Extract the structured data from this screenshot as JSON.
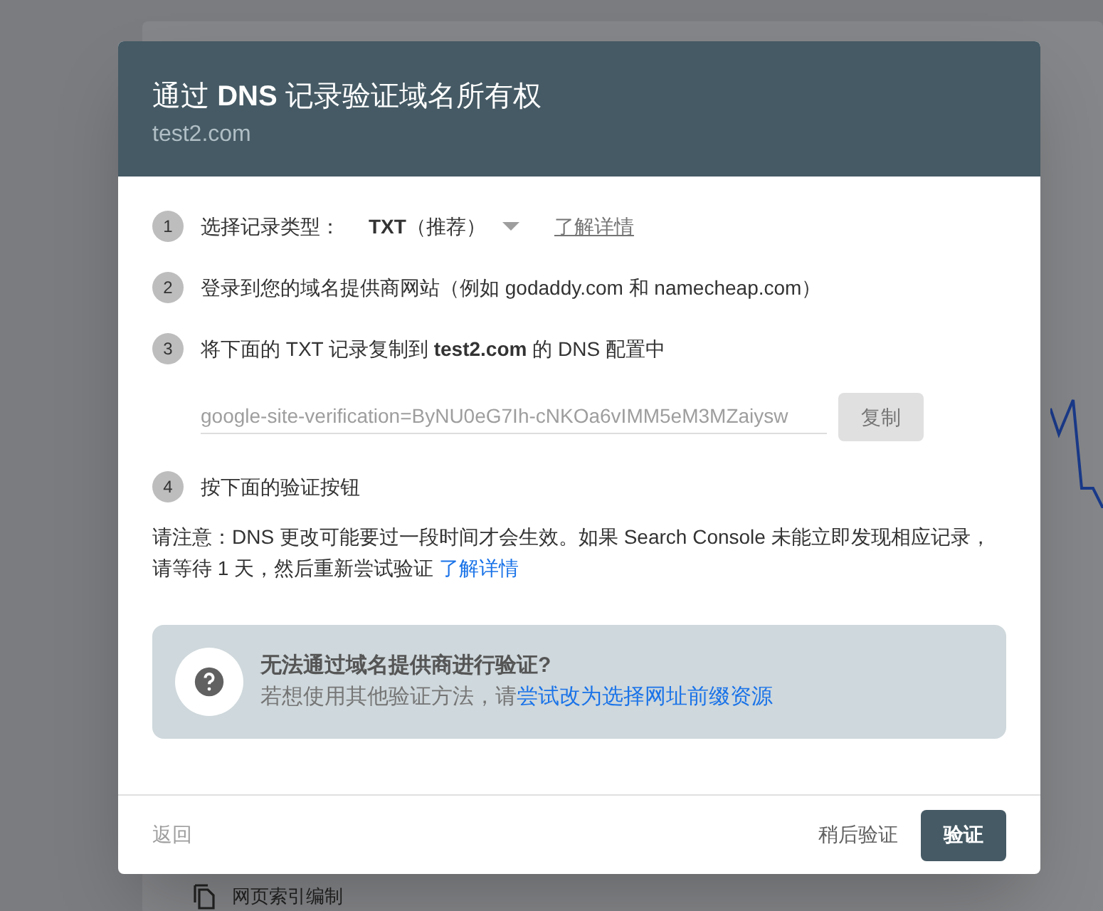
{
  "background": {
    "nav_item": {
      "label": "网页索引编制"
    }
  },
  "dialog": {
    "title": "通过 **DNS** 记录验证域名所有权",
    "subtitle": "test2.com",
    "steps": [
      {
        "number": "1",
        "kind": "select",
        "text": "选择记录类型：",
        "select_value": "**TXT**（推荐）",
        "link": "了解详情"
      },
      {
        "number": "2",
        "kind": "text",
        "text": "登录到您的域名提供商网站（例如 godaddy.com 和 namecheap.com）"
      },
      {
        "number": "3",
        "kind": "record",
        "text": "将下面的 TXT 记录复制到 **test2.com** 的 DNS 配置中",
        "record_value": "google-site-verification=ByNU0eG7Ih-cNKOa6vIMM5eM3MZaiysw",
        "copy_button": "复制"
      },
      {
        "number": "4",
        "kind": "text",
        "text": "按下面的验证按钮"
      }
    ],
    "note": {
      "text": "请注意：DNS 更改可能要过一段时间才会生效。如果 Search Console 未能立即发现相应记录，请等待 1 天，然后重新尝试验证",
      "link": "了解详情"
    },
    "help": {
      "title": "无法通过域名提供商进行验证?",
      "text": "若想使用其他验证方法，请",
      "link": "尝试改为选择网址前缀资源"
    },
    "footer": {
      "back": "返回",
      "later": "稍后验证",
      "verify": "验证"
    }
  }
}
